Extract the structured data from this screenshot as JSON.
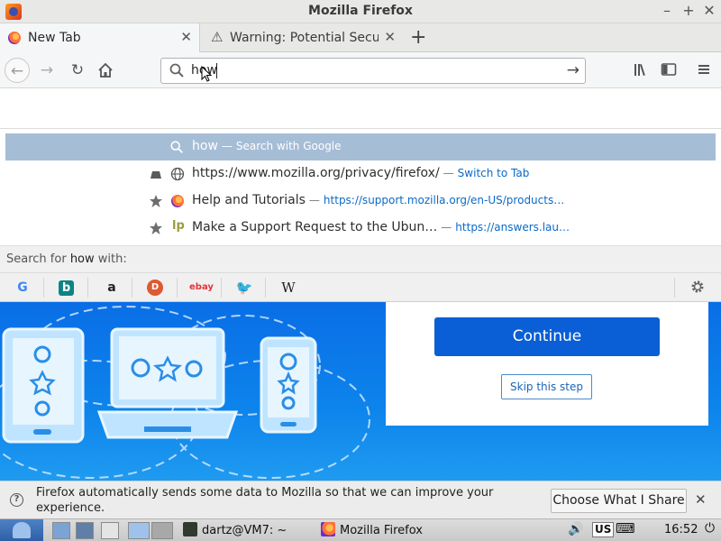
{
  "window": {
    "title": "Mozilla Firefox"
  },
  "tabs": [
    {
      "label": "New Tab",
      "active": true
    },
    {
      "label": "Warning: Potential Secu",
      "active": false
    }
  ],
  "urlbar": {
    "value": "how"
  },
  "suggestions": {
    "selected": {
      "term": "how",
      "action": "Search with Google"
    },
    "items": [
      {
        "text": "https://www.mozilla.org/privacy/firefox/",
        "action": "Switch to Tab",
        "icon": "globe-icon",
        "badge": "tab-icon"
      },
      {
        "text": "Help and Tutorials",
        "link": "https://support.mozilla.org/en-US/products…",
        "icon": "firefox-icon",
        "badge": "star-icon"
      },
      {
        "text": "Make a Support Request to the Ubun…",
        "link": "https://answers.lau…",
        "icon": "launchpad-icon",
        "badge": "star-icon"
      }
    ],
    "search_for_prefix": "Search for ",
    "search_for_term": "how",
    "search_for_suffix": " with:",
    "engines": [
      "google",
      "bing",
      "amazon",
      "duckduckgo",
      "ebay",
      "twitter",
      "wikipedia"
    ]
  },
  "page": {
    "continue_label": "Continue",
    "skip_label": "Skip this step"
  },
  "notification": {
    "message": "Firefox automatically sends some data to Mozilla so that we can improve your experience.",
    "button_label": "Choose What I Share"
  },
  "taskbar": {
    "tasks": [
      {
        "label": "dartz@VM7: ~"
      },
      {
        "label": "Mozilla Firefox"
      }
    ],
    "keyboard": "US",
    "clock": "16:52"
  },
  "colors": {
    "accent_blue": "#0a5fd6",
    "selection": "#a6bdd6",
    "link": "#0a6ac9"
  }
}
